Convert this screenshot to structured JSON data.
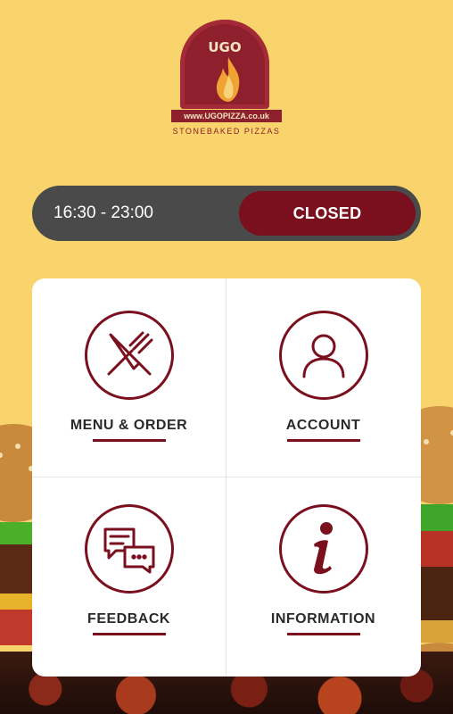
{
  "logo": {
    "name": "UGO",
    "url": "www.UGOPIZZA.co.uk",
    "tagline": "STONEBAKED PIZZAS"
  },
  "hours": {
    "time_range": "16:30 - 23:00",
    "status": "CLOSED"
  },
  "tiles": [
    {
      "label": "MENU & ORDER",
      "icon": "fork-knife-icon"
    },
    {
      "label": "ACCOUNT",
      "icon": "user-icon"
    },
    {
      "label": "FEEDBACK",
      "icon": "chat-bubbles-icon"
    },
    {
      "label": "INFORMATION",
      "icon": "info-icon"
    }
  ],
  "colors": {
    "background": "#f9d36b",
    "accent": "#7a0f1e",
    "bar": "#4a4a4a"
  }
}
